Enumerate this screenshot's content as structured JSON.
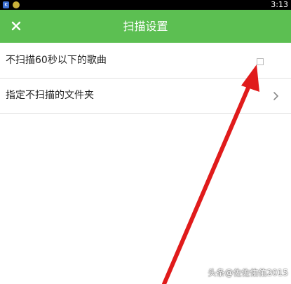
{
  "status_bar": {
    "time": "3:13",
    "icon_left_label": "K"
  },
  "header": {
    "title": "扫描设置",
    "close_icon": "close-icon",
    "background_color": "#5cbf52"
  },
  "settings": [
    {
      "label": "不扫描60秒以下的歌曲",
      "control": "checkbox",
      "checked": false
    },
    {
      "label": "指定不扫描的文件夹",
      "control": "chevron"
    }
  ],
  "annotation": {
    "arrow_color": "#e01b1b"
  },
  "watermark": "头条@佐佐佑佑2015"
}
